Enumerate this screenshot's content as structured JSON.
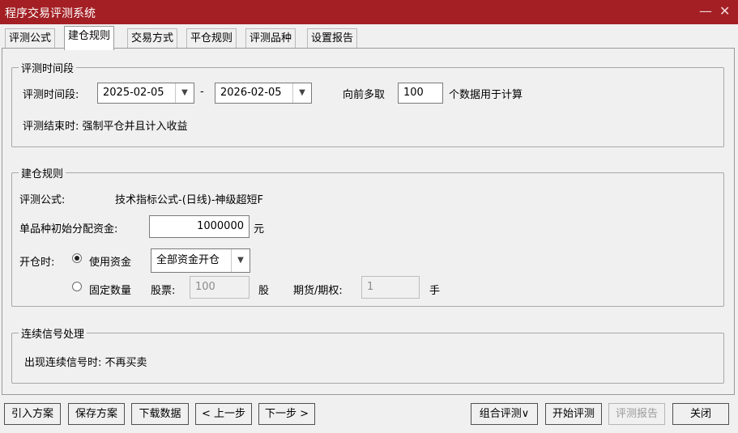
{
  "window": {
    "title": "程序交易评测系统",
    "minimize_glyph": "—",
    "close_glyph": "✕"
  },
  "tabs": [
    "评测公式",
    "建仓规则",
    "交易方式",
    "平仓规则",
    "评测品种",
    "设置报告"
  ],
  "active_tab": "建仓规则",
  "period_group": {
    "legend": "评测时间段",
    "label": "评测时间段:",
    "start_date": "2025-02-05",
    "separator": "-",
    "end_date": "2026-02-05",
    "lookback_label": "向前多取",
    "lookback_value": "100",
    "lookback_suffix": "个数据用于计算",
    "end_note": "评测结束时: 强制平仓并且计入收益"
  },
  "build_group": {
    "legend": "建仓规则",
    "formula_label": "评测公式:",
    "formula_value": "技术指标公式-(日线)-神级超短F",
    "capital_label": "单品种初始分配资金:",
    "capital_value": "1000000",
    "capital_unit": "元",
    "open_label": "开仓时:",
    "use_capital_option": "使用资金",
    "use_capital_checked": true,
    "capital_mode_value": "全部资金开仓",
    "fixed_qty_option": "固定数量",
    "fixed_qty_checked": false,
    "stock_label": "股票:",
    "stock_value": "100",
    "stock_unit": "股",
    "futures_label": "期货/期权:",
    "futures_value": "1",
    "futures_unit": "手"
  },
  "signal_group": {
    "legend": "连续信号处理",
    "note": "出现连续信号时: 不再买卖"
  },
  "buttons": {
    "import": "引入方案",
    "save": "保存方案",
    "download": "下载数据",
    "prev": "< 上一步",
    "next": "下一步 >",
    "combo": "组合评测∨",
    "start": "开始评测",
    "report": "评测报告",
    "close": "关闭"
  },
  "colors": {
    "titlebar": "#a31f24",
    "dialog_bg": "#f0f0f0"
  },
  "icons": {
    "dropdown": "chevron-down-icon"
  }
}
